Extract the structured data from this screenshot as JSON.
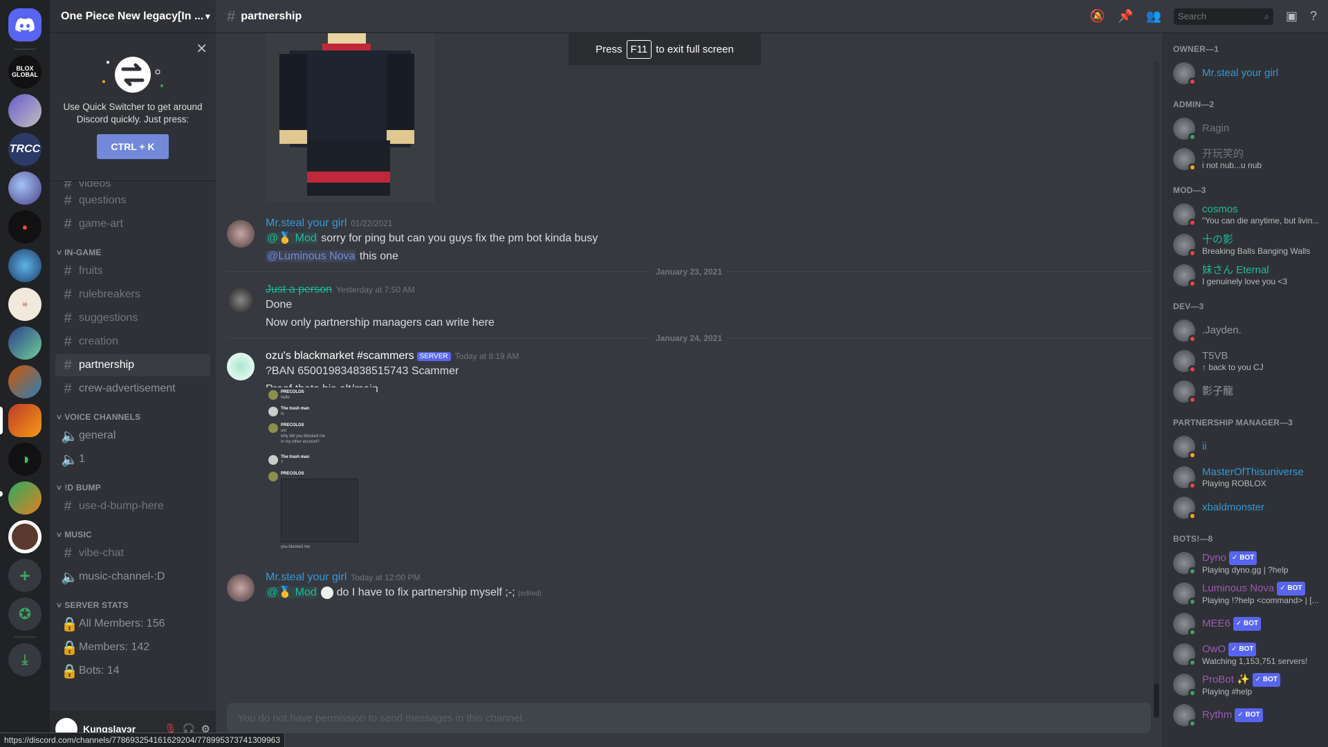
{
  "server": {
    "name": "One Piece New legacy[In ..."
  },
  "quick_switcher": {
    "text": "Use Quick Switcher to get around Discord quickly. Just press:",
    "shortcut": "CTRL + K"
  },
  "categories": {
    "in_game": "IN-GAME",
    "voice": "VOICE CHANNELS",
    "bump": "!D BUMP",
    "music": "MUSIC",
    "stats": "SERVER STATS"
  },
  "channels": {
    "videos": "videos",
    "questions": "questions",
    "game_art": "game-art",
    "fruits": "fruits",
    "rulebreakers": "rulebreakers",
    "suggestions": "suggestions",
    "creation": "creation",
    "partnership": "partnership",
    "crew_ad": "crew-advertisement",
    "general": "general",
    "one": "1",
    "bump": "use-d-bump-here",
    "vibe_chat": "vibe-chat",
    "music": "music-channel-:D",
    "all_members": "All Members: 156",
    "members": "Members: 142",
    "bots": "Bots: 14"
  },
  "user": {
    "name": "Kuŋgslayэr"
  },
  "topbar": {
    "channel": "partnership",
    "search_placeholder": "Search"
  },
  "toast": {
    "press": "Press",
    "key": "F11",
    "rest": "to exit full screen"
  },
  "messages": [
    {
      "author": "Mr.steal your girl",
      "time": "01/22/2021",
      "line1_role": "Mod",
      "line1_text": "sorry for ping but can you guys fix the pm bot kinda busy",
      "line2_mention": "@Luminous Nova",
      "line2_text": "this one"
    },
    {
      "author": "Just a person",
      "time": "Yesterday at 7:50 AM",
      "line1": "Done",
      "line2": "Now only partnership managers can write here"
    },
    {
      "author": "ozu's blackmarket #scammers",
      "tag": "SERVER",
      "time": "Today at 8:19 AM",
      "line1": "?BAN 650019834838515743 Scammer",
      "line2": "Proof thats his alt/main"
    },
    {
      "author": "Mr.steal your girl",
      "time": "Today at 12:00 PM",
      "role": "Mod",
      "text": "do I have to fix partnership myself ;-;",
      "edited": "(edited)"
    }
  ],
  "dividers": [
    "January 23, 2021",
    "January 24, 2021"
  ],
  "proof": {
    "l1": "PRECOLOS",
    "l2": "hello",
    "l3": "The trash man",
    "l4": "hi",
    "l5": "PRECOLOS",
    "l6": "um",
    "l7": "why did you blocked me",
    "l8": "in my other account?",
    "l9": "The trash man",
    "l10": "?",
    "l11": "PRECOLOS",
    "l12": "you blocked me"
  },
  "composer": {
    "placeholder": "You do not have permission to send messages in this channel."
  },
  "status_url": "https://discord.com/channels/778693254161629204/778995373741309963",
  "member_groups": [
    {
      "title": "OWNER—1",
      "members": [
        {
          "name": "Mr.steal your girl",
          "color": "#3498db",
          "sub": "",
          "status": "#ed4245"
        }
      ]
    },
    {
      "title": "ADMIN—2",
      "members": [
        {
          "name": "Ragin",
          "color": "#72767d",
          "sub": "",
          "status": "#3ba55d"
        },
        {
          "name": "开玩笑的",
          "color": "#72767d",
          "sub": "i not nub...u nub",
          "status": "#faa61a"
        }
      ]
    },
    {
      "title": "MOD—3",
      "members": [
        {
          "name": "cosmos",
          "color": "#1abc9c",
          "sub": "\"You can die anytime, but livin...",
          "status": "#ed4245"
        },
        {
          "name": "十の影",
          "color": "#1abc9c",
          "sub": "Breaking Balls Banging Walls",
          "status": "#ed4245"
        },
        {
          "name": "妹さん Eternal",
          "color": "#1abc9c",
          "sub": "I genuinely love you <3",
          "status": "#ed4245"
        }
      ]
    },
    {
      "title": "DEV—3",
      "members": [
        {
          "name": ".Jayden.",
          "color": "#96989d",
          "sub": "",
          "status": "#ed4245"
        },
        {
          "name": "T5VB",
          "color": "#96989d",
          "sub": "↑ back to you CJ",
          "status": "#ed4245"
        },
        {
          "name": "影子龍",
          "color": "#96989d",
          "sub": "",
          "status": "#ed4245"
        }
      ]
    },
    {
      "title": "PARTNERSHIP MANAGER—3",
      "members": [
        {
          "name": "ii",
          "color": "#3498db",
          "sub": "",
          "status": "#faa61a"
        },
        {
          "name": "MasterOfThisuniverse",
          "color": "#3498db",
          "sub": "Playing ROBLOX",
          "status": "#ed4245"
        },
        {
          "name": "xbaldmonster",
          "color": "#3498db",
          "sub": "",
          "status": "#faa61a"
        }
      ]
    },
    {
      "title": "BOTS!—8",
      "members": [
        {
          "name": "Dyno",
          "color": "#9b59b6",
          "sub": "Playing dyno.gg | ?help",
          "status": "#3ba55d",
          "bot": "✓ BOT"
        },
        {
          "name": "Luminous Nova",
          "color": "#9b59b6",
          "sub": "Playing !?help <command> | [...",
          "status": "#3ba55d",
          "bot": "✓ BOT"
        },
        {
          "name": "MEE6",
          "color": "#9b59b6",
          "sub": "",
          "status": "#3ba55d",
          "bot": "✓ BOT"
        },
        {
          "name": "OwO",
          "color": "#9b59b6",
          "sub": "Watching 1,153,751 servers!",
          "status": "#3ba55d",
          "bot": "✓ BOT"
        },
        {
          "name": "ProBot ✨",
          "color": "#9b59b6",
          "sub": "Playing #help",
          "status": "#3ba55d",
          "bot": "✓ BOT"
        },
        {
          "name": "Rythm",
          "color": "#9b59b6",
          "sub": "",
          "status": "#3ba55d",
          "bot": "✓ BOT"
        }
      ]
    }
  ]
}
